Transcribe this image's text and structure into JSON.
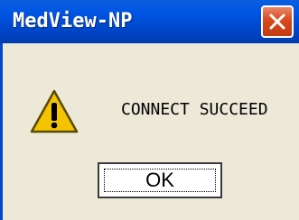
{
  "window": {
    "title": "MedView-NP"
  },
  "dialog": {
    "message": "CONNECT SUCCEED",
    "ok_label": "OK"
  },
  "icons": {
    "close": "close-icon",
    "warning": "warning-icon"
  },
  "colors": {
    "titlebar": "#0054e3",
    "close_button": "#d9481e",
    "background": "#ece9d8",
    "warning_fill": "#f5c400"
  }
}
